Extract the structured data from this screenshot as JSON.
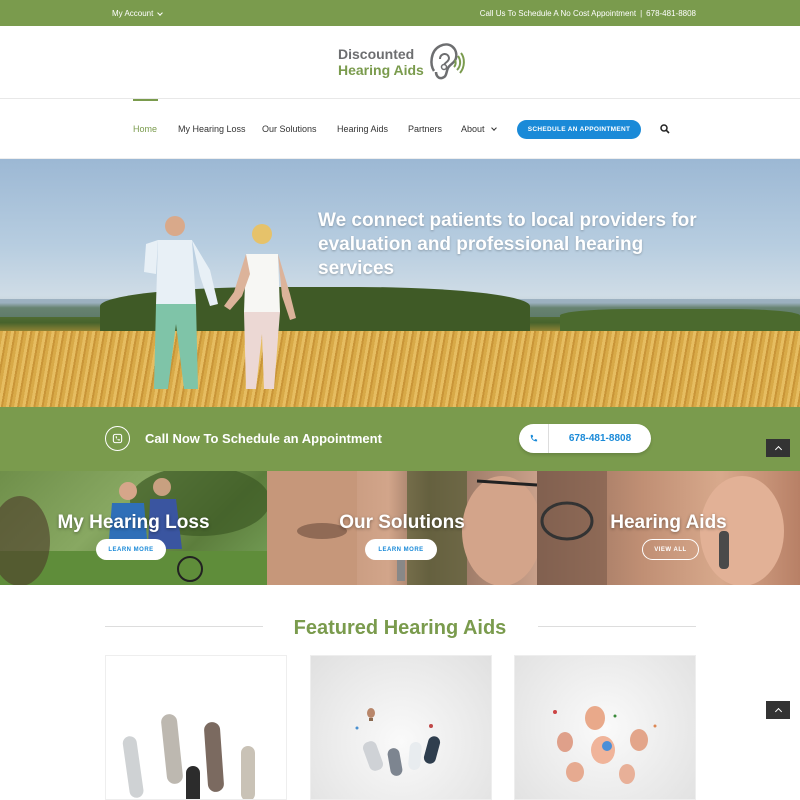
{
  "topbar": {
    "account_label": "My Account",
    "schedule_text": "Call Us To Schedule A No Cost Appointment",
    "separator": "|",
    "phone": "678-481-8808"
  },
  "logo": {
    "line1": "Discounted",
    "line2": "Hearing Aids"
  },
  "nav": {
    "items": [
      {
        "label": "Home"
      },
      {
        "label": "My Hearing Loss"
      },
      {
        "label": "Our Solutions"
      },
      {
        "label": "Hearing Aids"
      },
      {
        "label": "Partners"
      },
      {
        "label": "About"
      }
    ],
    "cta_label": "SCHEDULE AN APPOINTMENT"
  },
  "hero": {
    "headline": "We connect patients to local providers for evaluation and professional hearing services"
  },
  "callbar": {
    "text": "Call Now To Schedule an Appointment",
    "phone": "678-481-8808"
  },
  "panels": [
    {
      "title": "My Hearing Loss",
      "button": "LEARN MORE"
    },
    {
      "title": "Our Solutions",
      "button": "LEARN MORE"
    },
    {
      "title": "Hearing Aids",
      "button": "VIEW ALL"
    }
  ],
  "featured": {
    "title": "Featured Hearing Aids"
  },
  "colors": {
    "brand_green": "#7a9b4d",
    "accent_blue": "#1a8ad8",
    "logo_gray": "#6d6e70"
  },
  "icons": {
    "search": "search-icon",
    "phone": "phone-icon",
    "caret": "chevron-down-icon",
    "back_to_top": "chevron-up-icon",
    "ear": "ear-logo-icon"
  }
}
